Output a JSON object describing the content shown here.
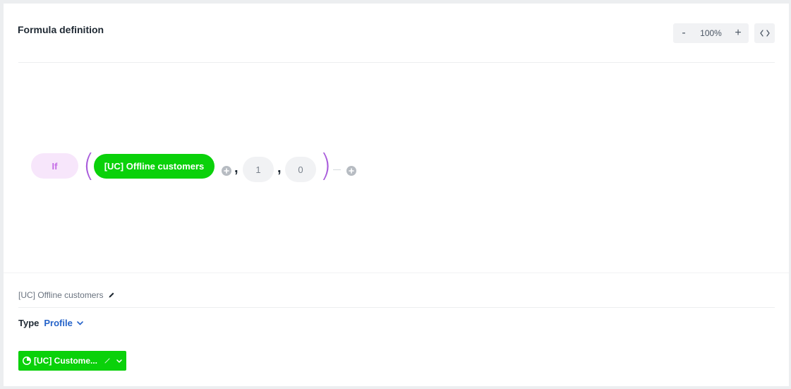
{
  "header": {
    "title": "Formula definition",
    "zoom_out_label": "-",
    "zoom_value": "100%",
    "zoom_in_label": "+",
    "code_toggle_icon": "code-brackets-icon"
  },
  "formula": {
    "function_label": "If",
    "condition_label": "[UC] Offline customers",
    "separator": ",",
    "true_value": "1",
    "false_value": "0",
    "open_paren": "(",
    "close_paren": ")"
  },
  "details": {
    "segment_name": "[UC] Offline customers",
    "type_label": "Type",
    "type_value": "Profile",
    "button_label": "[UC] Custome..."
  },
  "colors": {
    "accent_green": "#0ad10a",
    "function_purple": "#c46be6",
    "link_blue": "#2563c9"
  }
}
